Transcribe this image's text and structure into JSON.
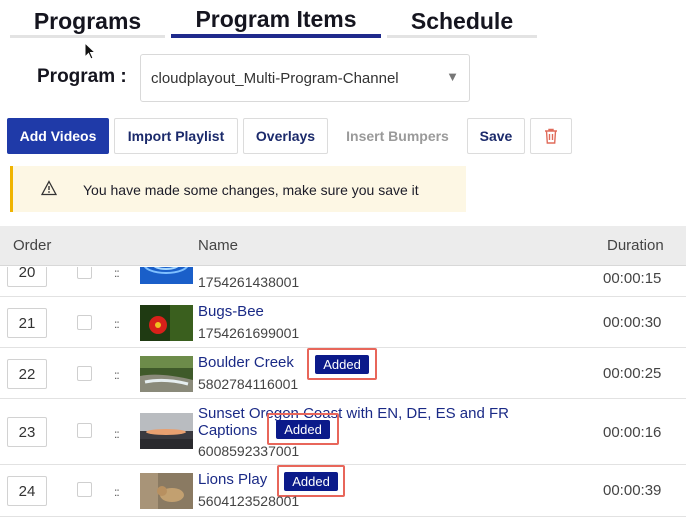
{
  "tabs": [
    {
      "label": "Programs",
      "active": false
    },
    {
      "label": "Program Items",
      "active": true
    },
    {
      "label": "Schedule",
      "active": false
    }
  ],
  "program": {
    "label": "Program :",
    "selected": "cloudplayout_Multi-Program-Channel"
  },
  "toolbar": {
    "add_videos": "Add Videos",
    "import_playlist": "Import Playlist",
    "overlays": "Overlays",
    "insert_bumpers": "Insert Bumpers",
    "save": "Save",
    "delete_icon": "trash-icon"
  },
  "warning": {
    "text": "You have made some changes, make sure you save it",
    "icon": "warning-triangle-icon"
  },
  "table": {
    "headers": {
      "order": "Order",
      "name": "Name",
      "duration": "Duration"
    },
    "rows": [
      {
        "order": "20",
        "name": "",
        "id": "1754261438001",
        "duration": "00:00:15",
        "added": false,
        "thumb": "water-drop"
      },
      {
        "order": "21",
        "name": "Bugs-Bee",
        "id": "1754261699001",
        "duration": "00:00:30",
        "added": false,
        "thumb": "red-flower"
      },
      {
        "order": "22",
        "name": "Boulder Creek",
        "id": "5802784116001",
        "duration": "00:00:25",
        "added": true,
        "thumb": "creek"
      },
      {
        "order": "23",
        "name": "Sunset Oregon Coast with EN, DE, ES and FR Captions",
        "id": "6008592337001",
        "duration": "00:00:16",
        "added": true,
        "thumb": "sunset-coast"
      },
      {
        "order": "24",
        "name": "Lions Play",
        "id": "5604123528001",
        "duration": "00:00:39",
        "added": true,
        "thumb": "lions"
      }
    ],
    "added_label": "Added"
  },
  "colors": {
    "primary": "#1f3aa8",
    "active_tab": "#1f2a8c",
    "badge": "#0b1a8a",
    "highlight": "#e8665a",
    "warning_bar": "#f0b400"
  }
}
